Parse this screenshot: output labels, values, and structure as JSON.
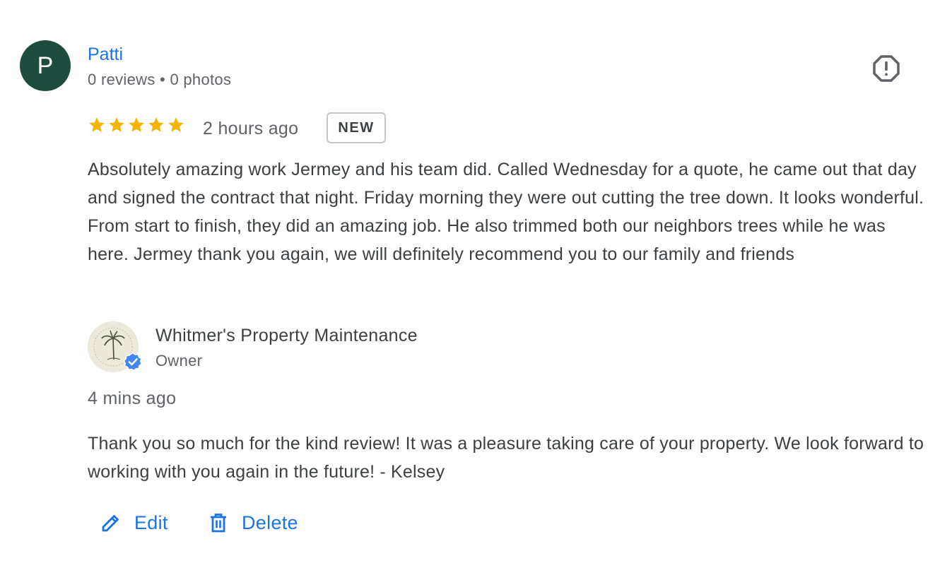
{
  "reviewer": {
    "initial": "P",
    "name": "Patti",
    "meta": "0 reviews • 0 photos",
    "avatar_color": "#1e4d40"
  },
  "review": {
    "rating": 5,
    "rating_max": 5,
    "time_ago": "2 hours ago",
    "badge": "NEW",
    "text": "Absolutely amazing work Jermey and his team did. Called Wednesday for a quote, he came out that day and signed the contract that night. Friday morning they were out cutting the tree down. It looks wonderful. From start to finish, they did an amazing job. He also trimmed both our neighbors trees while he was here. Jermey thank you again, we will definitely recommend you to our family and friends"
  },
  "owner_reply": {
    "business_name": "Whitmer's Property Maintenance",
    "role": "Owner",
    "time_ago": "4 mins ago",
    "text": "Thank you so much for the kind review! It was a pleasure taking care of your property. We look forward to working with you again in the future! - Kelsey",
    "verified_badge_color": "#4285f4"
  },
  "actions": {
    "edit_label": "Edit",
    "delete_label": "Delete"
  },
  "icons": {
    "report": "report-flag-icon",
    "star": "star-icon",
    "edit": "pencil-icon",
    "delete": "trash-icon",
    "verified": "verified-check-icon"
  },
  "colors": {
    "link_blue": "#1a73e8",
    "star_gold": "#f4b400",
    "text": "#3c4043",
    "secondary_text": "#5f6368"
  }
}
